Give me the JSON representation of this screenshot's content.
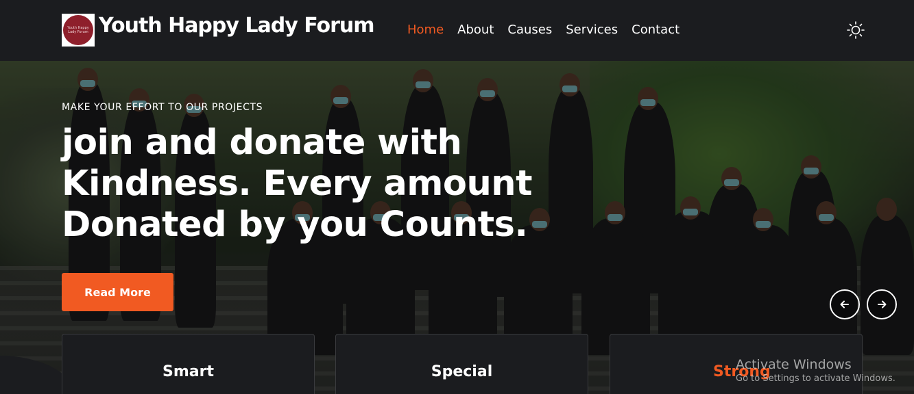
{
  "brand": {
    "name": "Youth Happy Lady Forum",
    "logo_text": "Youth Happy Lady Forum"
  },
  "nav": {
    "items": [
      {
        "label": "Home",
        "active": true
      },
      {
        "label": "About",
        "active": false
      },
      {
        "label": "Causes",
        "active": false
      },
      {
        "label": "Services",
        "active": false
      },
      {
        "label": "Contact",
        "active": false
      }
    ],
    "theme_icon": "sun-icon"
  },
  "hero": {
    "tagline": "MAKE YOUR EFFORT TO OUR PROJECTS",
    "headline": "join and donate with Kindness. Every amount Donated by you Counts.",
    "button_label": "Read More",
    "prev_icon": "arrow-left-icon",
    "next_icon": "arrow-right-icon"
  },
  "cards": [
    {
      "title": "Smart"
    },
    {
      "title": "Special"
    },
    {
      "title": "Strong"
    }
  ],
  "watermark": {
    "title": "Activate Windows",
    "subtitle": "Go to Settings to activate Windows."
  },
  "colors": {
    "accent": "#f15a22",
    "background": "#1b1c1f",
    "logo": "#8e1f2b"
  }
}
